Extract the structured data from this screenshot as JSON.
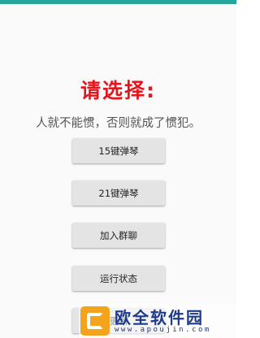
{
  "header": {
    "title": "请选择:",
    "subtitle": "人就不能惯，否则就成了惯犯。"
  },
  "buttons": [
    {
      "label": "15键弹琴"
    },
    {
      "label": "21键弹琴"
    },
    {
      "label": "加入群聊"
    },
    {
      "label": "运行状态"
    },
    {
      "label": "更新"
    }
  ],
  "watermark": {
    "logo": "AP",
    "title": "欧全软件园",
    "url": "www.apoujin.com"
  },
  "colors": {
    "status_bar": "#26a69a",
    "title": "#e8141b",
    "watermark": "#1e3a8a",
    "logo": "#f4a41c"
  }
}
